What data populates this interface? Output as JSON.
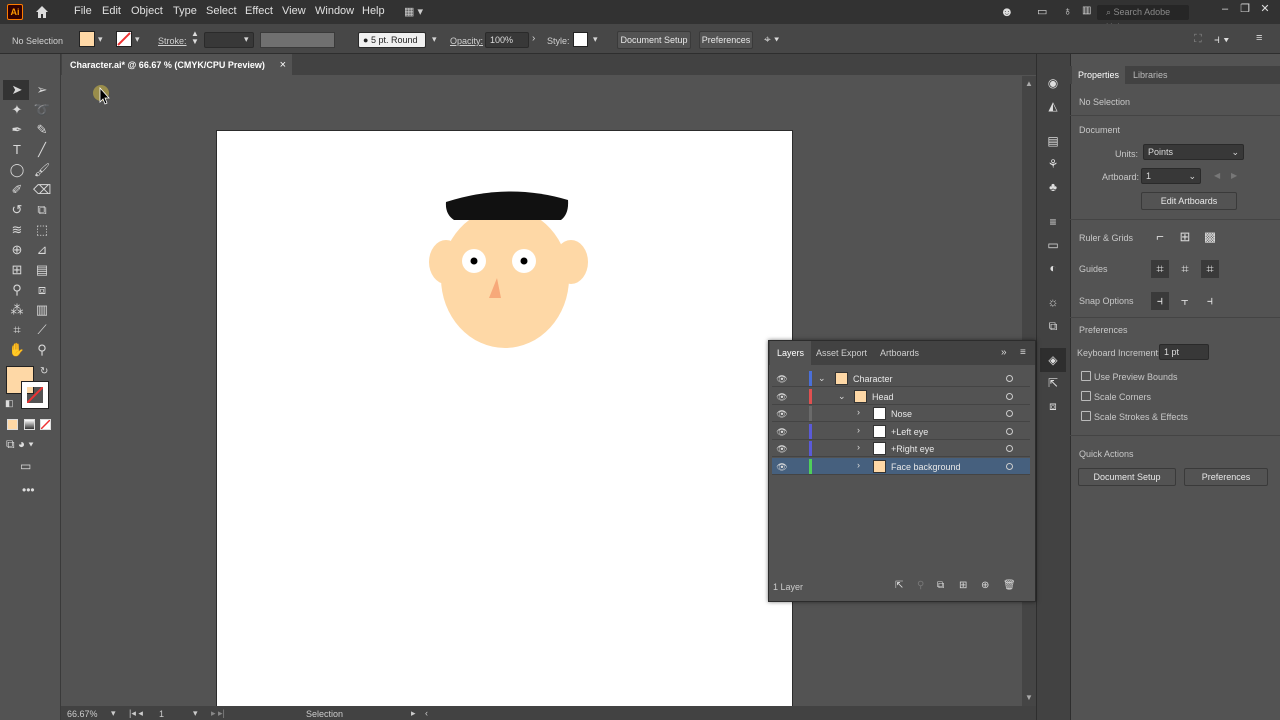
{
  "app": {
    "logo": "Ai"
  },
  "menu": [
    "File",
    "Edit",
    "Object",
    "Type",
    "Select",
    "Effect",
    "View",
    "Window",
    "Help"
  ],
  "search_placeholder": "Search Adobe Help",
  "control_bar": {
    "selection_label": "No Selection",
    "stroke_label": "Stroke:",
    "brush_label": "5 pt. Round",
    "opacity_label": "Opacity:",
    "opacity_value": "100%",
    "style_label": "Style:",
    "document_setup": "Document Setup",
    "preferences": "Preferences"
  },
  "document_tab": {
    "title": "Character.ai* @ 66.67 % (CMYK/CPU Preview)",
    "close": "×"
  },
  "status_bar": {
    "zoom": "66.67%",
    "artboard": "1",
    "tool": "Selection"
  },
  "properties": {
    "tabs": [
      "Properties",
      "Libraries"
    ],
    "selection": "No Selection",
    "document_heading": "Document",
    "units_label": "Units:",
    "units_value": "Points",
    "artboard_label": "Artboard:",
    "artboard_value": "1",
    "edit_artboards": "Edit Artboards",
    "ruler_grids": "Ruler & Grids",
    "guides": "Guides",
    "snap_options": "Snap Options",
    "preferences_heading": "Preferences",
    "keyboard_increment_label": "Keyboard Increment:",
    "keyboard_increment_value": "1 pt",
    "use_preview_bounds": "Use Preview Bounds",
    "scale_corners": "Scale Corners",
    "scale_strokes": "Scale Strokes & Effects",
    "quick_actions": "Quick Actions",
    "qa_document_setup": "Document Setup",
    "qa_preferences": "Preferences"
  },
  "layers_panel": {
    "tabs": [
      "Layers",
      "Asset Export",
      "Artboards"
    ],
    "rows": [
      {
        "name": "Character",
        "color": "#4a6fd8"
      },
      {
        "name": "Head",
        "color": "#e05050"
      },
      {
        "name": "Nose",
        "color": "#6a6a6a"
      },
      {
        "name": "+Left eye",
        "color": "#5a5ad8"
      },
      {
        "name": "+Right eye",
        "color": "#5a5ad8"
      },
      {
        "name": "Face background",
        "color": "#4fcf5a"
      }
    ],
    "footer": "1 Layer"
  },
  "colors": {
    "accent_selected_row": "#46607e",
    "face": "#fed8a6",
    "hat": "#111111",
    "fill_swatch": "#fed8a6"
  }
}
